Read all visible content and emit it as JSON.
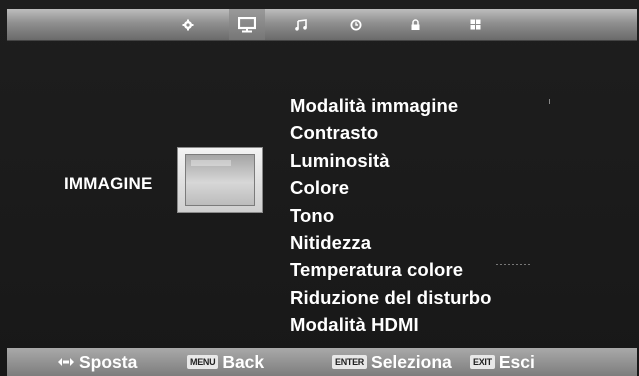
{
  "tabs": [
    {
      "icon": "gear-icon"
    },
    {
      "icon": "monitor-icon"
    },
    {
      "icon": "music-note-icon"
    },
    {
      "icon": "clock-icon"
    },
    {
      "icon": "lock-icon"
    },
    {
      "icon": "grid-icon"
    }
  ],
  "active_tab": "monitor-icon",
  "category": {
    "label": "IMMAGINE",
    "icon": "tv-screen-icon"
  },
  "menu": {
    "items": [
      "Modalità immagine",
      "Contrasto",
      "Luminosità",
      "Colore",
      "Tono",
      "Nitidezza",
      "Temperatura colore",
      "Riduzione del disturbo",
      "Modalità HDMI"
    ]
  },
  "footer": {
    "move_label": "Sposta",
    "menu_key": "MENU",
    "back_label": "Back",
    "enter_key": "ENTER",
    "select_label": "Seleziona",
    "exit_key": "EXIT",
    "exit_label": "Esci"
  },
  "colors": {
    "background": "#1c1c1c",
    "bar": "#9a9a9a",
    "text": "#ffffff"
  }
}
